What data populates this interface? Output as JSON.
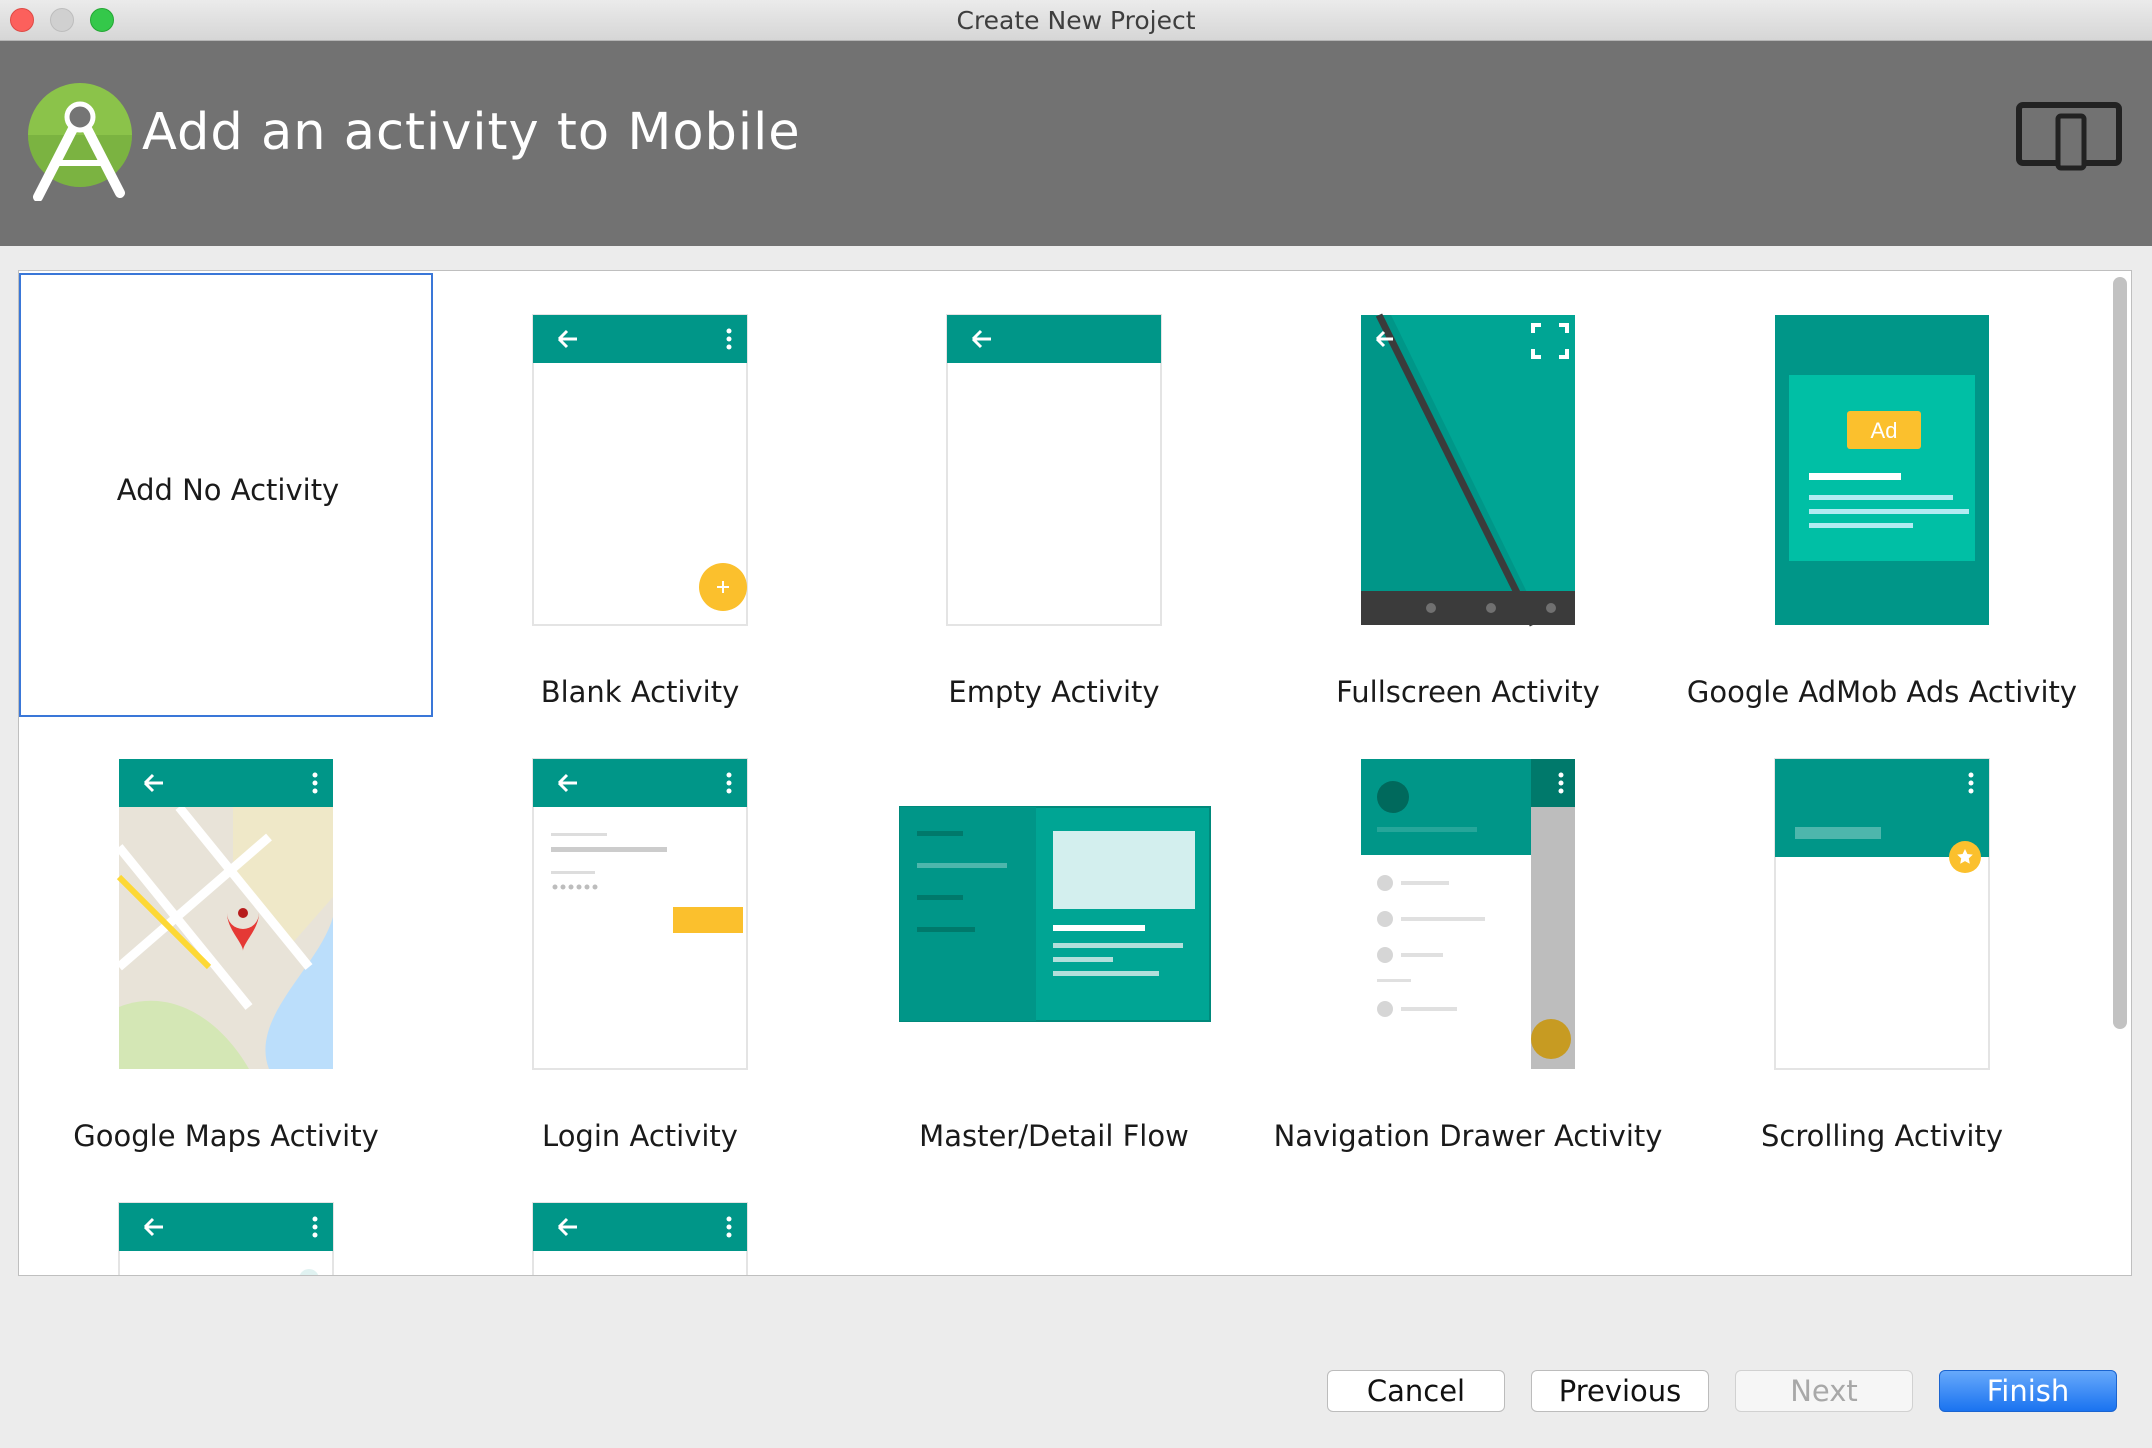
{
  "window": {
    "title": "Create New Project"
  },
  "header": {
    "title": "Add an activity to Mobile"
  },
  "gallery": {
    "tiles": [
      {
        "label": "Add No Activity"
      },
      {
        "label": "Blank Activity"
      },
      {
        "label": "Empty Activity"
      },
      {
        "label": "Fullscreen Activity"
      },
      {
        "label": "Google AdMob Ads Activity"
      },
      {
        "label": "Google Maps Activity"
      },
      {
        "label": "Login Activity"
      },
      {
        "label": "Master/Detail Flow"
      },
      {
        "label": "Navigation Drawer Activity"
      },
      {
        "label": "Scrolling Activity"
      }
    ],
    "admob_badge": "Ad"
  },
  "buttons": {
    "cancel": "Cancel",
    "previous": "Previous",
    "next": "Next",
    "finish": "Finish"
  },
  "colors": {
    "teal": "#009688",
    "teal_light": "#00b8a5",
    "accent_yellow": "#fbc02d",
    "selection_blue": "#3a77d8"
  }
}
